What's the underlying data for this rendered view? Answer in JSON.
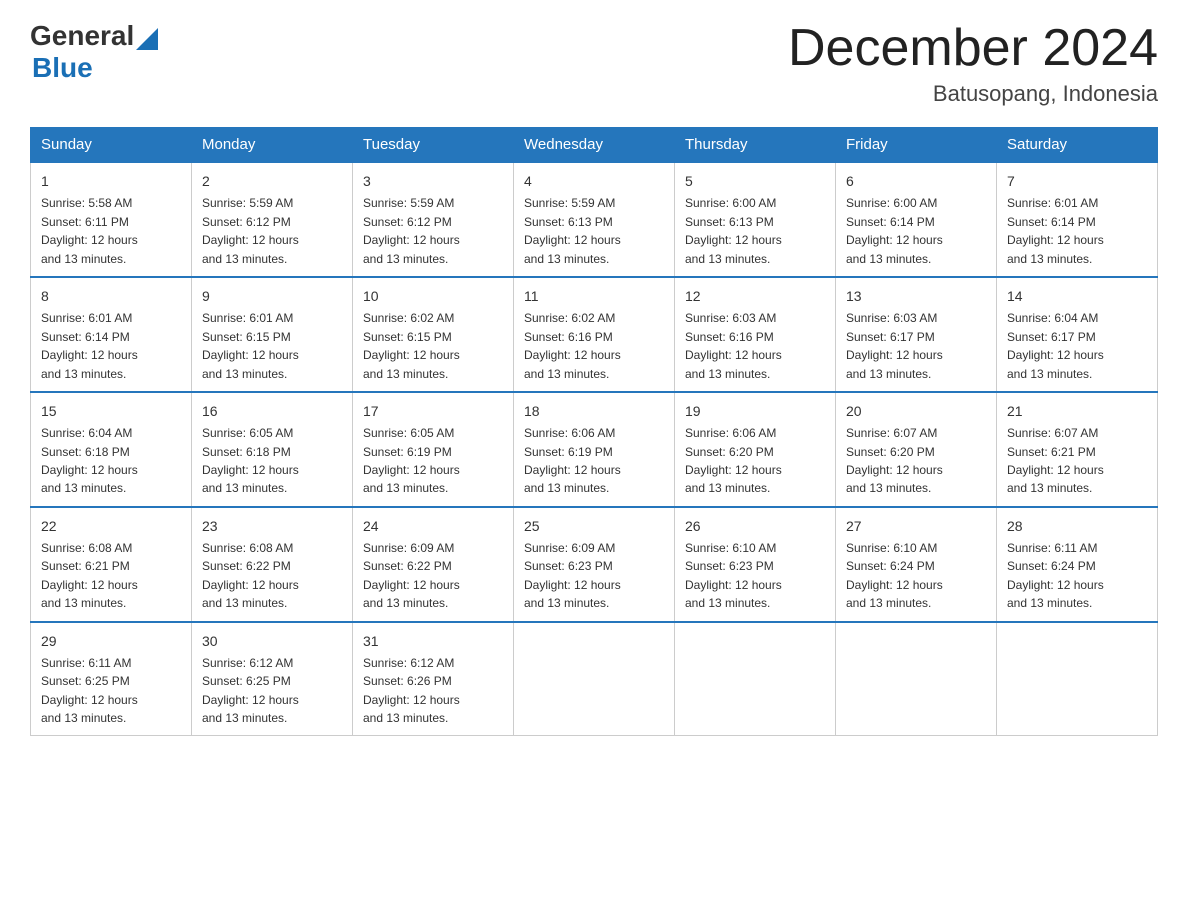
{
  "logo": {
    "general": "General",
    "blue": "Blue",
    "triangle": "▲"
  },
  "title": "December 2024",
  "subtitle": "Batusopang, Indonesia",
  "days_of_week": [
    "Sunday",
    "Monday",
    "Tuesday",
    "Wednesday",
    "Thursday",
    "Friday",
    "Saturday"
  ],
  "weeks": [
    [
      {
        "day": "1",
        "sunrise": "5:58 AM",
        "sunset": "6:11 PM",
        "daylight": "12 hours and 13 minutes."
      },
      {
        "day": "2",
        "sunrise": "5:59 AM",
        "sunset": "6:12 PM",
        "daylight": "12 hours and 13 minutes."
      },
      {
        "day": "3",
        "sunrise": "5:59 AM",
        "sunset": "6:12 PM",
        "daylight": "12 hours and 13 minutes."
      },
      {
        "day": "4",
        "sunrise": "5:59 AM",
        "sunset": "6:13 PM",
        "daylight": "12 hours and 13 minutes."
      },
      {
        "day": "5",
        "sunrise": "6:00 AM",
        "sunset": "6:13 PM",
        "daylight": "12 hours and 13 minutes."
      },
      {
        "day": "6",
        "sunrise": "6:00 AM",
        "sunset": "6:14 PM",
        "daylight": "12 hours and 13 minutes."
      },
      {
        "day": "7",
        "sunrise": "6:01 AM",
        "sunset": "6:14 PM",
        "daylight": "12 hours and 13 minutes."
      }
    ],
    [
      {
        "day": "8",
        "sunrise": "6:01 AM",
        "sunset": "6:14 PM",
        "daylight": "12 hours and 13 minutes."
      },
      {
        "day": "9",
        "sunrise": "6:01 AM",
        "sunset": "6:15 PM",
        "daylight": "12 hours and 13 minutes."
      },
      {
        "day": "10",
        "sunrise": "6:02 AM",
        "sunset": "6:15 PM",
        "daylight": "12 hours and 13 minutes."
      },
      {
        "day": "11",
        "sunrise": "6:02 AM",
        "sunset": "6:16 PM",
        "daylight": "12 hours and 13 minutes."
      },
      {
        "day": "12",
        "sunrise": "6:03 AM",
        "sunset": "6:16 PM",
        "daylight": "12 hours and 13 minutes."
      },
      {
        "day": "13",
        "sunrise": "6:03 AM",
        "sunset": "6:17 PM",
        "daylight": "12 hours and 13 minutes."
      },
      {
        "day": "14",
        "sunrise": "6:04 AM",
        "sunset": "6:17 PM",
        "daylight": "12 hours and 13 minutes."
      }
    ],
    [
      {
        "day": "15",
        "sunrise": "6:04 AM",
        "sunset": "6:18 PM",
        "daylight": "12 hours and 13 minutes."
      },
      {
        "day": "16",
        "sunrise": "6:05 AM",
        "sunset": "6:18 PM",
        "daylight": "12 hours and 13 minutes."
      },
      {
        "day": "17",
        "sunrise": "6:05 AM",
        "sunset": "6:19 PM",
        "daylight": "12 hours and 13 minutes."
      },
      {
        "day": "18",
        "sunrise": "6:06 AM",
        "sunset": "6:19 PM",
        "daylight": "12 hours and 13 minutes."
      },
      {
        "day": "19",
        "sunrise": "6:06 AM",
        "sunset": "6:20 PM",
        "daylight": "12 hours and 13 minutes."
      },
      {
        "day": "20",
        "sunrise": "6:07 AM",
        "sunset": "6:20 PM",
        "daylight": "12 hours and 13 minutes."
      },
      {
        "day": "21",
        "sunrise": "6:07 AM",
        "sunset": "6:21 PM",
        "daylight": "12 hours and 13 minutes."
      }
    ],
    [
      {
        "day": "22",
        "sunrise": "6:08 AM",
        "sunset": "6:21 PM",
        "daylight": "12 hours and 13 minutes."
      },
      {
        "day": "23",
        "sunrise": "6:08 AM",
        "sunset": "6:22 PM",
        "daylight": "12 hours and 13 minutes."
      },
      {
        "day": "24",
        "sunrise": "6:09 AM",
        "sunset": "6:22 PM",
        "daylight": "12 hours and 13 minutes."
      },
      {
        "day": "25",
        "sunrise": "6:09 AM",
        "sunset": "6:23 PM",
        "daylight": "12 hours and 13 minutes."
      },
      {
        "day": "26",
        "sunrise": "6:10 AM",
        "sunset": "6:23 PM",
        "daylight": "12 hours and 13 minutes."
      },
      {
        "day": "27",
        "sunrise": "6:10 AM",
        "sunset": "6:24 PM",
        "daylight": "12 hours and 13 minutes."
      },
      {
        "day": "28",
        "sunrise": "6:11 AM",
        "sunset": "6:24 PM",
        "daylight": "12 hours and 13 minutes."
      }
    ],
    [
      {
        "day": "29",
        "sunrise": "6:11 AM",
        "sunset": "6:25 PM",
        "daylight": "12 hours and 13 minutes."
      },
      {
        "day": "30",
        "sunrise": "6:12 AM",
        "sunset": "6:25 PM",
        "daylight": "12 hours and 13 minutes."
      },
      {
        "day": "31",
        "sunrise": "6:12 AM",
        "sunset": "6:26 PM",
        "daylight": "12 hours and 13 minutes."
      },
      null,
      null,
      null,
      null
    ]
  ],
  "labels": {
    "sunrise": "Sunrise:",
    "sunset": "Sunset:",
    "daylight": "Daylight:"
  }
}
